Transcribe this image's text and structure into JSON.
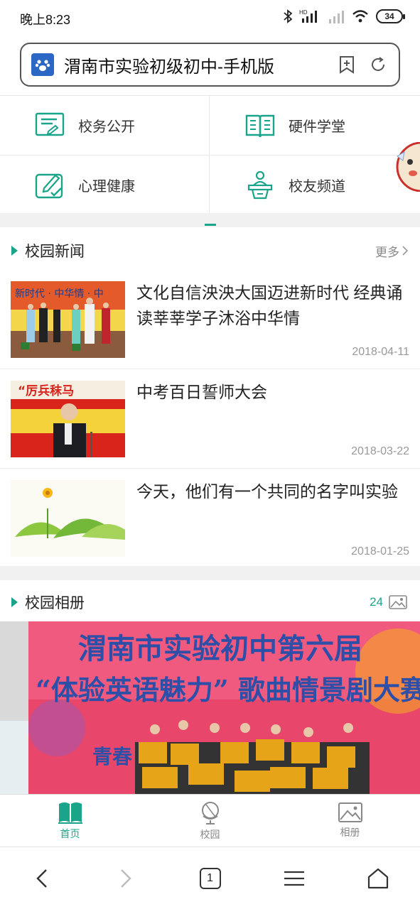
{
  "status_bar": {
    "time": "晚上8:23",
    "battery": "34",
    "hd_label": "HD"
  },
  "browser": {
    "page_title": "渭南市实验初级初中-手机版",
    "tab_count": "1"
  },
  "quick_links": [
    {
      "label": "校务公开",
      "icon": "notice-board-icon"
    },
    {
      "label": "硬件学堂",
      "icon": "open-book-icon"
    },
    {
      "label": "心理健康",
      "icon": "pencil-check-icon"
    },
    {
      "label": "校友频道",
      "icon": "speaker-podium-icon"
    }
  ],
  "news": {
    "title": "校园新闻",
    "more": "更多",
    "items": [
      {
        "title": "文化自信泱泱大国迈进新时代 经典诵读莘莘学子沐浴中华情",
        "date": "2018-04-11",
        "thumb_text": "新时代 · 中华情 · 中"
      },
      {
        "title": "中考百日誓师大会",
        "date": "2018-03-22",
        "thumb_text": "“厉兵秣马"
      },
      {
        "title": "今天，他们有一个共同的名字叫实验",
        "date": "2018-01-25"
      }
    ]
  },
  "album": {
    "title": "校园相册",
    "count": "24",
    "photo_banner_line1": "渭南市实验初中第六届",
    "photo_banner_line2": "“体验英语魅力” 歌曲情景剧大赛",
    "photo_banner_line3": "青春"
  },
  "tabs": [
    {
      "label": "首页",
      "icon": "home-book-icon",
      "active": true
    },
    {
      "label": "校园",
      "icon": "globe-icon",
      "active": false
    },
    {
      "label": "相册",
      "icon": "image-icon",
      "active": false
    }
  ],
  "colors": {
    "accent": "#1aa58b",
    "banner_red": "#d9241c",
    "banner_yellow": "#f4d23c"
  }
}
